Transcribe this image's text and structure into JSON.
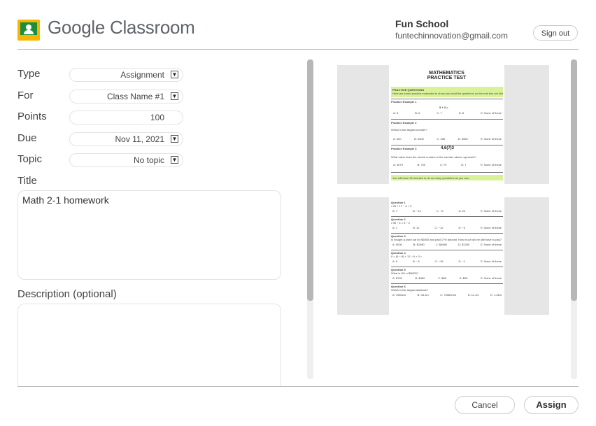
{
  "header": {
    "brand_google": "Google",
    "brand_classroom": " Classroom",
    "school_name": "Fun School",
    "account_email": "funtechinnovation@gmail.com",
    "sign_out_label": "Sign out",
    "logo_colors": {
      "frame": "#f9b600",
      "board": "#1e8e3e"
    }
  },
  "form": {
    "type_label": "Type",
    "type_value": "Assignment",
    "for_label": "For",
    "for_value": "Class Name #1",
    "points_label": "Points",
    "points_value": "100",
    "due_label": "Due",
    "due_value": "Nov 11, 2021",
    "topic_label": "Topic",
    "topic_value": "No topic",
    "title_label": "Title",
    "title_value": "Math 2-1 homework",
    "description_label": "Description (optional)",
    "description_value": "",
    "dropdown_glyph": "▼"
  },
  "preview": {
    "page1": {
      "heading_line1": "MATHEMATICS",
      "heading_line2": "PRACTICE TEST",
      "intro_title": "PRACTICE QUESTIONS",
      "intro_text": "Here are some practice examples to show you what the questions on the real test are like.",
      "ex1_title": "Practice Example 1",
      "ex1_expr": "5 + 3 =",
      "ex1_options": [
        "A: 5",
        "B: 6",
        "C: 7",
        "D: 8",
        "E: None of these"
      ],
      "ex2_title": "Practice Example 2",
      "ex2_question": "Which is the largest number?",
      "ex2_options": [
        "A: 400",
        "B: 4000",
        "C: 406",
        "D: 4060",
        "E: None of these"
      ],
      "ex3_title": "Practice Example 3",
      "ex3_number": "4,6(7)3",
      "ex3_question": "What value does the circled number in the number above represent?",
      "ex3_options": [
        "A: 4079",
        "B: 700",
        "C: 70",
        "D: 7",
        "E: None of these"
      ],
      "footer_note": "You will have 30 minutes to do as many questions as you can."
    },
    "page2": {
      "questions": [
        {
          "title": "Question 1",
          "text": "• 28 + 17 − 6 + 9",
          "options": [
            "A: 7",
            "B: −12",
            "C: −6",
            "D: 24",
            "E: None of these"
          ]
        },
        {
          "title": "Question 2",
          "text": "• 96 ÷ 4 × 3 ÷ 2",
          "options": [
            "A: 1",
            "B: 12",
            "C: −12",
            "D: −3",
            "E: None of these"
          ]
        },
        {
          "title": "Question 3",
          "text": "Is bought a used car for $6000 and paid 17% deposit. How much did he still have to pay?",
          "options": [
            "A: 5000",
            "B: $1980",
            "C: $4980",
            "D: $1300",
            "E: None of these"
          ]
        },
        {
          "title": "Question 4",
          "text": "9 × (5 − 8) + 12 ÷ 6 × 3 =",
          "options": [
            "A: 6",
            "B: −3",
            "C: −18",
            "D: −1",
            "E: None of these"
          ]
        },
        {
          "title": "Question 5",
          "text": "What is 6% of $4800?",
          "options": [
            "A: $700",
            "B: $480",
            "C: $88",
            "D: $28",
            "E: None of these"
          ]
        },
        {
          "title": "Question 6",
          "text": "Which is the largest distance?",
          "options": [
            "A: 1960cm",
            "B: 43.1m",
            "C: 70060mm",
            "D: 11.1m",
            "E: 1.2km"
          ]
        }
      ]
    }
  },
  "footer": {
    "cancel_label": "Cancel",
    "assign_label": "Assign"
  }
}
